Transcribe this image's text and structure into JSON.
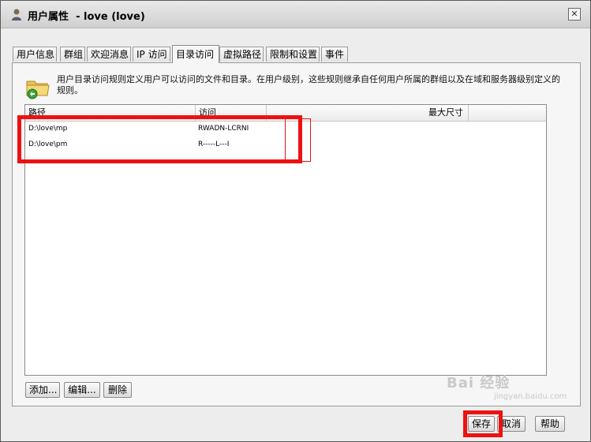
{
  "window": {
    "title": "用户属性",
    "subtitle": "- love (love)",
    "close_glyph": "✕"
  },
  "tabs": [
    {
      "label": "用户信息",
      "active": false
    },
    {
      "label": "群组",
      "active": false
    },
    {
      "label": "欢迎消息",
      "active": false
    },
    {
      "label": "IP 访问",
      "active": false
    },
    {
      "label": "目录访问",
      "active": true
    },
    {
      "label": "虚拟路径",
      "active": false
    },
    {
      "label": "限制和设置",
      "active": false
    },
    {
      "label": "事件",
      "active": false
    }
  ],
  "panel": {
    "description": "用户目录访问规则定义用户可以访问的文件和目录。在用户级别，这些规则继承自任何用户所属的群组以及在域和服务器级别定义的规则。",
    "icon": "folder-icon"
  },
  "table": {
    "headers": [
      "路径",
      "访问",
      "最大尺寸"
    ],
    "rows": [
      {
        "path": "D:\\love\\mp",
        "access": "RWADN-LCRNI"
      },
      {
        "path": "D:\\love\\pm",
        "access": "R-----L---I"
      }
    ]
  },
  "buttons": {
    "add": "添加...",
    "edit": "编辑...",
    "delete": "删除",
    "save": "保存",
    "cancel": "取消",
    "help": "帮助"
  },
  "colors": {
    "highlight": "#ee1111",
    "titlebar": "#d8d8d8"
  },
  "watermark": {
    "brand": "Bai 经验",
    "url": "jingyan.baidu.com"
  }
}
